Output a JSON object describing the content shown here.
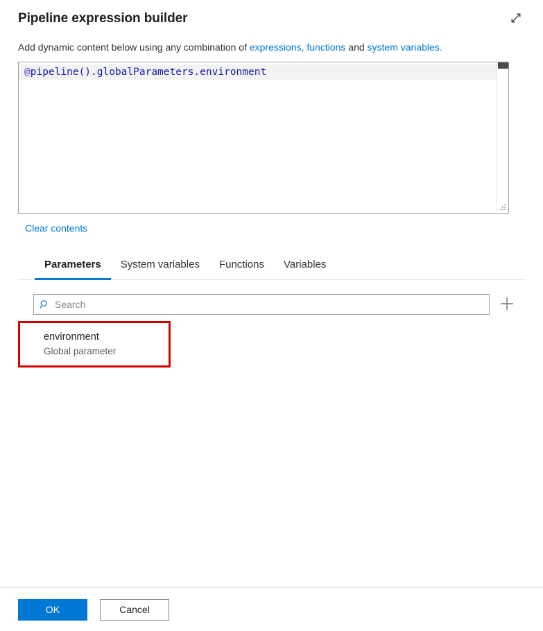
{
  "header": {
    "title": "Pipeline expression builder",
    "expand_icon": "expand-diagonal-icon"
  },
  "subtitle": {
    "prefix": "Add dynamic content below using any combination of ",
    "link_expressions": "expressions, functions",
    "middle": " and ",
    "link_system_variables": "system variables.",
    "link_color": "#0078d4"
  },
  "editor": {
    "expression_at": "@",
    "expression_body": "pipeline().globalParameters.environment",
    "full_expression": "@pipeline().globalParameters.environment",
    "scrollbar": "vertical-scrollbar",
    "resize_handle": "resize-grip-icon"
  },
  "clear_contents_label": "Clear contents",
  "tabs": [
    {
      "label": "Parameters",
      "active": true
    },
    {
      "label": "System variables",
      "active": false
    },
    {
      "label": "Functions",
      "active": false
    },
    {
      "label": "Variables",
      "active": false
    }
  ],
  "search": {
    "placeholder": "Search",
    "value": "",
    "icon": "search-icon",
    "add_icon": "plus-icon"
  },
  "parameters": [
    {
      "name": "environment",
      "description": "Global parameter",
      "highlighted": true,
      "highlight_color": "#d50000"
    }
  ],
  "footer": {
    "ok_label": "OK",
    "cancel_label": "Cancel",
    "primary_color": "#0078d4"
  }
}
